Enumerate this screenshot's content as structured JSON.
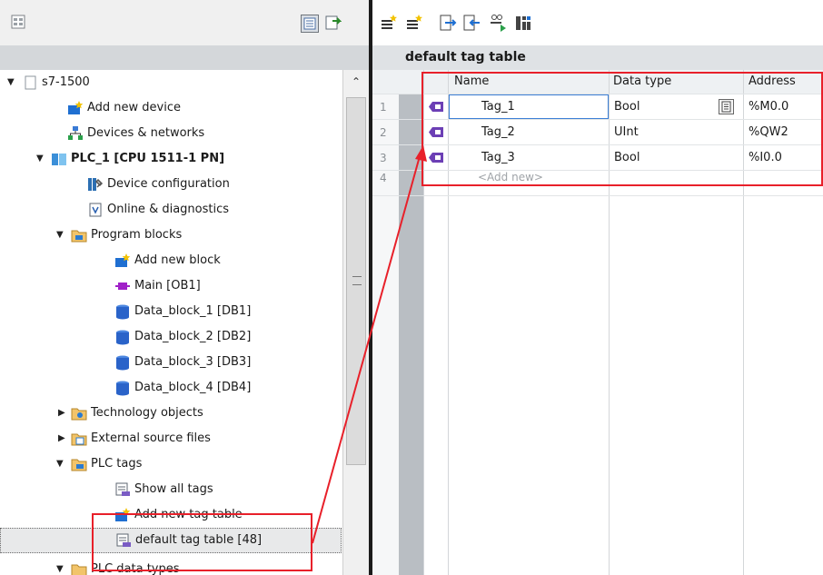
{
  "project_tree": {
    "items": [
      {
        "label": "s7-1500",
        "icon": "project-icon",
        "expand": "down"
      },
      {
        "label": "Add new device",
        "icon": "add-device-icon",
        "expand": ""
      },
      {
        "label": "Devices & networks",
        "icon": "network-icon",
        "expand": ""
      },
      {
        "label": "PLC_1 [CPU 1511-1 PN]",
        "icon": "plc-icon",
        "expand": "down"
      },
      {
        "label": "Device configuration",
        "icon": "device-config-icon",
        "expand": ""
      },
      {
        "label": "Online & diagnostics",
        "icon": "diagnostics-icon",
        "expand": ""
      },
      {
        "label": "Program blocks",
        "icon": "folder-icon",
        "expand": "down"
      },
      {
        "label": "Add new block",
        "icon": "add-block-icon",
        "expand": ""
      },
      {
        "label": "Main [OB1]",
        "icon": "ob-block-icon",
        "expand": ""
      },
      {
        "label": "Data_block_1 [DB1]",
        "icon": "db-icon",
        "expand": ""
      },
      {
        "label": "Data_block_2 [DB2]",
        "icon": "db-icon",
        "expand": ""
      },
      {
        "label": "Data_block_3 [DB3]",
        "icon": "db-icon",
        "expand": ""
      },
      {
        "label": "Data_block_4 [DB4]",
        "icon": "db-icon",
        "expand": ""
      },
      {
        "label": "Technology objects",
        "icon": "folder-icon",
        "expand": "right"
      },
      {
        "label": "External source files",
        "icon": "folder-icon",
        "expand": "right"
      },
      {
        "label": "PLC tags",
        "icon": "folder-icon",
        "expand": "down"
      },
      {
        "label": "Show all tags",
        "icon": "show-tags-icon",
        "expand": ""
      },
      {
        "label": "Add new tag table",
        "icon": "add-tag-table-icon",
        "expand": ""
      },
      {
        "label": "default tag table [48]",
        "icon": "tag-table-icon",
        "expand": ""
      },
      {
        "label": "PLC data types",
        "icon": "folder-icon",
        "expand": "down"
      }
    ]
  },
  "tag_table": {
    "title": "default tag table",
    "columns": [
      "Name",
      "Data type",
      "Address"
    ],
    "rows": [
      {
        "num": "1",
        "name": "Tag_1",
        "type": "Bool",
        "address": "%M0.0"
      },
      {
        "num": "2",
        "name": "Tag_2",
        "type": "UInt",
        "address": "%QW2"
      },
      {
        "num": "3",
        "name": "Tag_3",
        "type": "Bool",
        "address": "%I0.0"
      }
    ],
    "add_row": {
      "num": "4",
      "placeholder": "<Add new>"
    }
  },
  "colors": {
    "highlight": "#e8202a",
    "header": "#dfe2e5"
  }
}
